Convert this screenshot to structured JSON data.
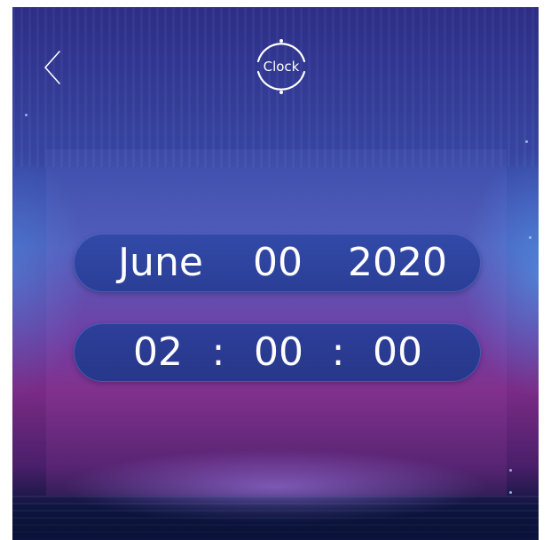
{
  "header": {
    "back_icon": "chevron-left-icon",
    "clock_label": "Clock"
  },
  "date": {
    "month": "June",
    "day": "00",
    "year": "2020"
  },
  "time": {
    "hours": "02",
    "minutes": "00",
    "seconds": "00",
    "separator": ":"
  },
  "colors": {
    "pill": "#2f45a2",
    "text": "#ffffff",
    "bg_top": "#2f2f8a",
    "bg_mid": "#7a2b85",
    "bg_bottom": "#0b1433"
  }
}
